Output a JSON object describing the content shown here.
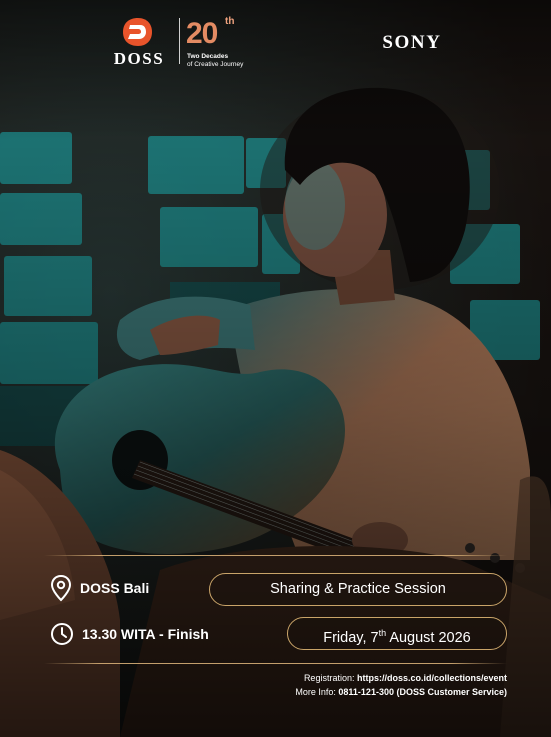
{
  "logos": {
    "doss_word": "DOSS",
    "anniversary_number": "20",
    "anniversary_suffix": "th",
    "anniversary_line1": "Two Decades",
    "anniversary_line2": "of Creative Journey",
    "sony": "SONY"
  },
  "event": {
    "location": "DOSS Bali",
    "location_icon": "location-pin-icon",
    "time": "13.30 WITA - Finish",
    "time_icon": "clock-icon",
    "session": "Sharing & Practice Session",
    "date_day": "Friday, 7",
    "date_suffix": "th",
    "date_rest": " August 2026"
  },
  "footer": {
    "registration_label": "Registration: ",
    "registration_url": "https://doss.co.id/collections/event",
    "info_label": "More Info: ",
    "info_value": "0811-121-300 (DOSS Customer Service)"
  },
  "colors": {
    "accent_gold": "#c9a469",
    "anniversary_orange": "#e38b63",
    "doss_orange": "#e8542b",
    "teal_light": "#17a8a8"
  }
}
